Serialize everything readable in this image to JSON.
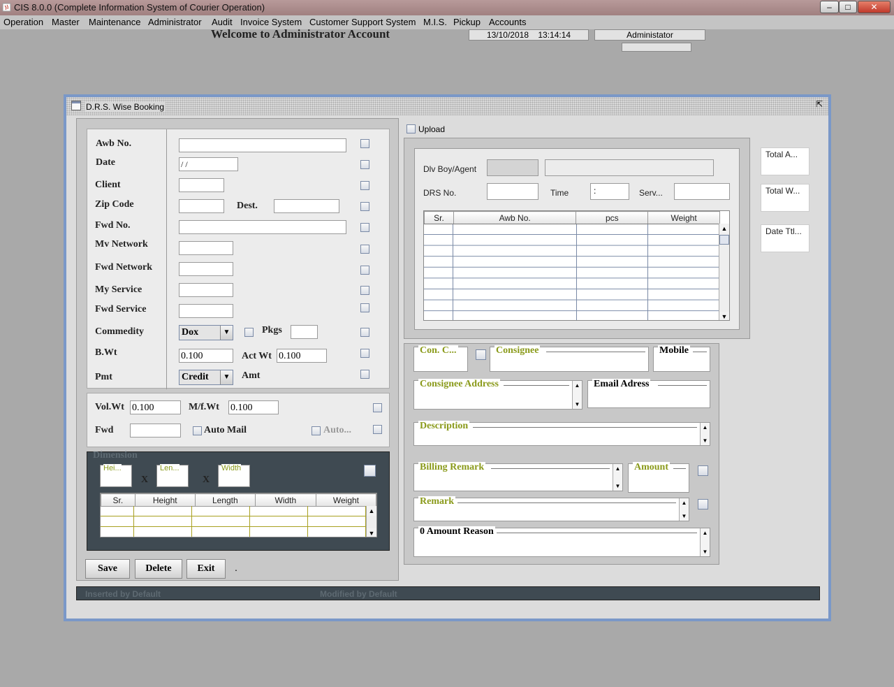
{
  "app": {
    "title": "CIS 8.0.0 (Complete Information System of Courier Operation)"
  },
  "window_controls": {
    "minimize": "‒",
    "maximize": "□",
    "close": "✕"
  },
  "menu": [
    {
      "label": "Operation"
    },
    {
      "label": "Master"
    },
    {
      "label": "Maintenance"
    },
    {
      "label": "Administrator"
    },
    {
      "label": "Audit"
    },
    {
      "label": "Invoice System"
    },
    {
      "label": "Customer Support System"
    },
    {
      "label": "M.I.S."
    },
    {
      "label": "Pickup"
    },
    {
      "label": "Accounts"
    }
  ],
  "header": {
    "welcome": "Welcome to Administrator Account",
    "date": "13/10/2018",
    "time": "13:14:14",
    "user": "Administator"
  },
  "frame": {
    "title": "D.R.S. Wise Booking",
    "maximize_icon": "⇱"
  },
  "form": {
    "awb_label": "Awb No.",
    "awb_value": "",
    "date_label": "Date",
    "date_value": " /  /",
    "client_label": "Client",
    "client_value": "",
    "zip_label": "Zip Code",
    "zip_value": "",
    "dest_label": "Dest.",
    "dest_value": "",
    "fwd_no_label": "Fwd No.",
    "fwd_no_value": "",
    "my_network_label": "Mv Network",
    "fwd_network_label": "Fwd Network",
    "my_service_label": "My Service",
    "fwd_service_label": "Fwd Service",
    "commodity_label": "Commedity",
    "commodity_value": "Dox",
    "pkgs_label": "Pkgs",
    "pkgs_value": "",
    "bwt_label": "B.Wt",
    "bwt_value": "0.100",
    "actwt_label": "Act Wt",
    "actwt_value": "0.100",
    "pmt_label": "Pmt",
    "pmt_value": "Credit",
    "amt_label": "Amt",
    "volwt_label": "Vol.Wt",
    "volwt_value": "0.100",
    "mfwt_label": "M/f.Wt",
    "mfwt_value": "0.100",
    "fwd_label": "Fwd",
    "fwd_value": "",
    "automail_label": "Auto Mail",
    "auto2_label": "Auto..."
  },
  "dimension": {
    "title": "Dimension",
    "height_label": "Hei...",
    "length_label": "Len...",
    "width_label": "Width",
    "x1": "X",
    "x2": "X",
    "columns": [
      "Sr.",
      "Height",
      "Length",
      "Width",
      "Weight"
    ]
  },
  "buttons": {
    "save": "Save",
    "delete": "Delete",
    "exit": "Exit",
    "dot": "."
  },
  "status": {
    "inserted": "Inserted by    Default",
    "modified": "Modified by  Default"
  },
  "drs": {
    "upload_label": "Upload",
    "dlv_label": "Dlv Boy/Agent",
    "drs_no_label": "DRS No.",
    "time_label": "Time",
    "time_value": ":",
    "serv_label": "Serv...",
    "columns": [
      "Sr.",
      "Awb No.",
      "pcs",
      "Weight"
    ]
  },
  "totals": {
    "total_amount": "Total A...",
    "total_weight": "Total W...",
    "date_total": "Date Ttl..."
  },
  "consignee": {
    "con_code_label": "Con. C...",
    "consignee_label": "Consignee",
    "mobile_label": "Mobile",
    "address_label": "Consignee Address",
    "email_label": "Email Adress",
    "description_label": "Description",
    "billing_remark_label": "Billing Remark",
    "amount_label": "Amount",
    "remark_label": "Remark",
    "zero_amount_label": "0 Amount Reason"
  },
  "icons": {
    "app": "java-icon",
    "scroll_up": "▲",
    "scroll_down": "▼",
    "combo_arrow": "▼"
  }
}
